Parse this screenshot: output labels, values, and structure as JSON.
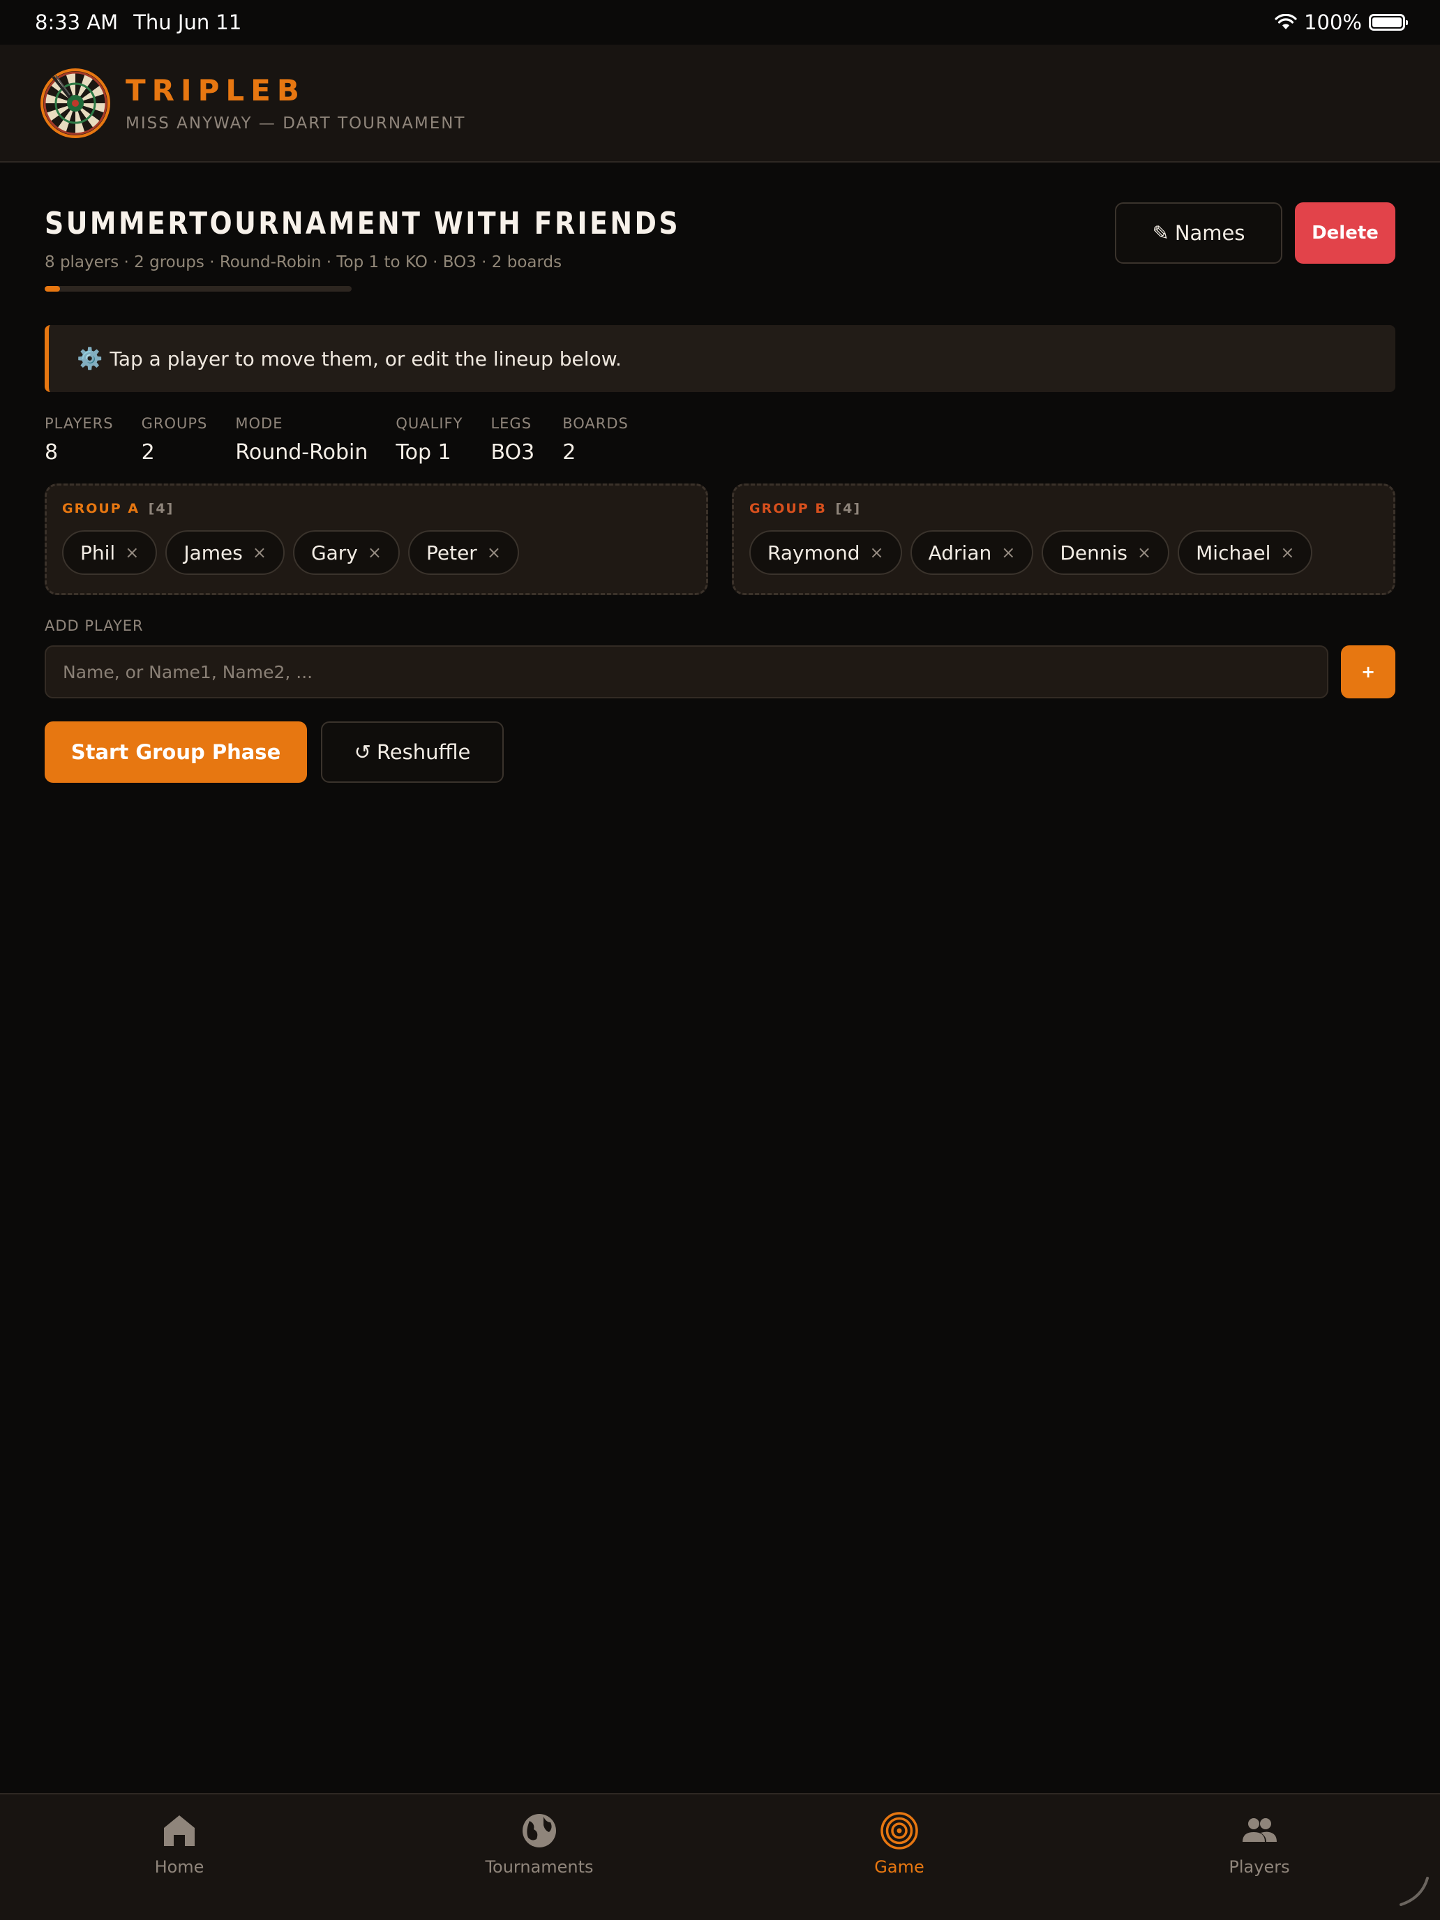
{
  "status_bar": {
    "time": "8:33 AM",
    "date": "Thu Jun 11",
    "battery": "100%"
  },
  "app": {
    "brand": "TRIPLEB",
    "tagline": "MISS ANYWAY — DART TOURNAMENT"
  },
  "tournament": {
    "title": "SUMMERTOURNAMENT WITH FRIENDS",
    "subtitle": "8 players · 2 groups · Round-Robin · Top 1 to KO · BO3 · 2 boards",
    "progress_fraction": 0.05
  },
  "actions": {
    "names_icon": "✎",
    "names_label": "Names",
    "delete_label": "Delete"
  },
  "banner": {
    "icon": "⚙️",
    "text": "Tap a player to move them, or edit the lineup below."
  },
  "stats": [
    {
      "label": "PLAYERS",
      "value": "8"
    },
    {
      "label": "GROUPS",
      "value": "2"
    },
    {
      "label": "MODE",
      "value": "Round-Robin"
    },
    {
      "label": "QUALIFY",
      "value": "Top 1"
    },
    {
      "label": "LEGS",
      "value": "BO3"
    },
    {
      "label": "BOARDS",
      "value": "2"
    }
  ],
  "groups": [
    {
      "name": "GROUP A",
      "count": "[4]",
      "players": [
        "Phil",
        "James",
        "Gary",
        "Peter"
      ]
    },
    {
      "name": "GROUP B",
      "count": "[4]",
      "players": [
        "Raymond",
        "Adrian",
        "Dennis",
        "Michael"
      ]
    }
  ],
  "chip_remove": "×",
  "add_player": {
    "label": "ADD PLAYER",
    "placeholder": "Name, or Name1, Name2, ...",
    "button": "+"
  },
  "controls": {
    "start_label": "Start Group Phase",
    "reshuffle_icon": "↺",
    "reshuffle_label": "Reshuffle"
  },
  "tabs": [
    {
      "label": "Home",
      "icon": "home-icon",
      "active": false
    },
    {
      "label": "Tournaments",
      "icon": "globe-icon",
      "active": false
    },
    {
      "label": "Game",
      "icon": "target-icon",
      "active": true
    },
    {
      "label": "Players",
      "icon": "people-icon",
      "active": false
    }
  ],
  "colors": {
    "accent": "#e77711",
    "danger": "#e2434a",
    "background": "#0b0a09",
    "panel": "#181411"
  }
}
